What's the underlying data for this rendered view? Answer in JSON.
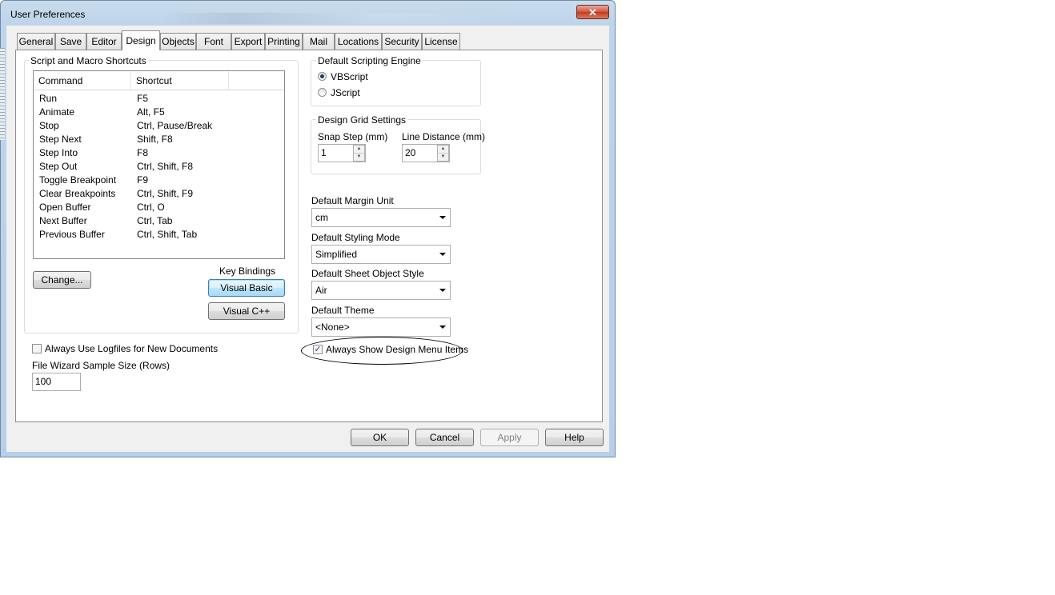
{
  "window": {
    "title": "User Preferences",
    "close_glyph": "✕"
  },
  "tabs": [
    {
      "label": "General"
    },
    {
      "label": "Save"
    },
    {
      "label": "Editor"
    },
    {
      "label": "Design"
    },
    {
      "label": "Objects"
    },
    {
      "label": "Font"
    },
    {
      "label": "Export"
    },
    {
      "label": "Printing"
    },
    {
      "label": "Mail"
    },
    {
      "label": "Locations"
    },
    {
      "label": "Security"
    },
    {
      "label": "License"
    }
  ],
  "active_tab": "Design",
  "shortcuts": {
    "group_title": "Script and Macro Shortcuts",
    "columns": [
      "Command",
      "Shortcut"
    ],
    "rows": [
      [
        "Run",
        "F5"
      ],
      [
        "Animate",
        "Alt, F5"
      ],
      [
        "Stop",
        "Ctrl, Pause/Break"
      ],
      [
        "Step Next",
        "Shift, F8"
      ],
      [
        "Step Into",
        "F8"
      ],
      [
        "Step Out",
        "Ctrl, Shift, F8"
      ],
      [
        "Toggle Breakpoint",
        "F9"
      ],
      [
        "Clear Breakpoints",
        "Ctrl, Shift, F9"
      ],
      [
        "Open Buffer",
        "Ctrl, O"
      ],
      [
        "Next Buffer",
        "Ctrl, Tab"
      ],
      [
        "Previous Buffer",
        "Ctrl, Shift, Tab"
      ]
    ],
    "change_button": "Change...",
    "key_bindings_label": "Key Bindings",
    "visual_basic_button": "Visual Basic",
    "visual_cpp_button": "Visual C++"
  },
  "logfiles": {
    "label": "Always Use Logfiles for New Documents",
    "checked": false
  },
  "file_wizard": {
    "label": "File Wizard Sample Size (Rows)",
    "value": "100"
  },
  "scripting_engine": {
    "group_title": "Default Scripting Engine",
    "options": [
      {
        "label": "VBScript",
        "selected": true
      },
      {
        "label": "JScript",
        "selected": false
      }
    ]
  },
  "design_grid": {
    "group_title": "Design Grid Settings",
    "snap_step_label": "Snap Step (mm)",
    "snap_step_value": "1",
    "line_distance_label": "Line Distance (mm)",
    "line_distance_value": "20",
    "spin_up": "▲",
    "spin_down": "▼"
  },
  "margin_unit": {
    "label": "Default Margin Unit",
    "value": "cm"
  },
  "styling_mode": {
    "label": "Default Styling Mode",
    "value": "Simplified"
  },
  "sheet_object_style": {
    "label": "Default Sheet Object Style",
    "value": "Air"
  },
  "theme": {
    "label": "Default Theme",
    "value": "<None>"
  },
  "show_design_menu": {
    "label": "Always Show Design Menu Items",
    "checked": true,
    "check_glyph": "✓"
  },
  "footer": {
    "ok": "OK",
    "cancel": "Cancel",
    "apply": "Apply",
    "help": "Help"
  },
  "colors": {
    "dialog_bg": "#f0f0f0",
    "frame": "#b9d1ea",
    "close_red": "#c94a32"
  }
}
